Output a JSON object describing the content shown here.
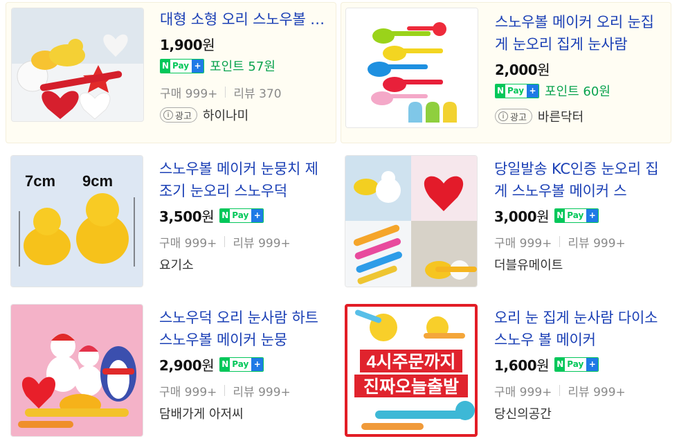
{
  "products": [
    {
      "title": "대형 소형 오리 스노우볼 메이커",
      "price": "1,900",
      "currency": "원",
      "npay": {
        "n": "N",
        "pay": "Pay",
        "plus": "+"
      },
      "point": "포인트 57원",
      "purchase": "구매 999+",
      "review": "리뷰 370",
      "ad_label": "광고",
      "ad_info": "i",
      "seller": "하이나미"
    },
    {
      "title": "스노우볼 메이커 오리 눈집게 눈오리 집게 눈사람",
      "price": "2,000",
      "currency": "원",
      "npay": {
        "n": "N",
        "pay": "Pay",
        "plus": "+"
      },
      "point": "포인트 60원",
      "ad_label": "광고",
      "ad_info": "i",
      "seller": "바른닥터"
    },
    {
      "title": "스노우볼 메이커 눈뭉치 제조기 눈오리 스노우덕",
      "price": "3,500",
      "currency": "원",
      "npay": {
        "n": "N",
        "pay": "Pay",
        "plus": "+"
      },
      "purchase": "구매 999+",
      "review": "리뷰 999+",
      "seller": "요기소",
      "image_text": {
        "left": "7cm",
        "right": "9cm"
      }
    },
    {
      "title": "당일발송 KC인증 눈오리 집게 스노우볼 메이커 스",
      "price": "3,000",
      "currency": "원",
      "npay": {
        "n": "N",
        "pay": "Pay",
        "plus": "+"
      },
      "purchase": "구매 999+",
      "review": "리뷰 999+",
      "seller": "더블유메이트"
    },
    {
      "title": "스노우덕 오리 눈사람 하트 스노우볼 메이커 눈뭉",
      "price": "2,900",
      "currency": "원",
      "npay": {
        "n": "N",
        "pay": "Pay",
        "plus": "+"
      },
      "purchase": "구매 999+",
      "review": "리뷰 999+",
      "seller": "담배가게 아저씨"
    },
    {
      "title": "오리 눈 집게 눈사람 다이소 스노우 볼 메이커",
      "price": "1,600",
      "currency": "원",
      "npay": {
        "n": "N",
        "pay": "Pay",
        "plus": "+"
      },
      "purchase": "구매 999+",
      "review": "리뷰 999+",
      "seller": "당신의공간",
      "image_text": {
        "line1": "4시주문까지",
        "line2": "진짜오늘출발"
      }
    }
  ],
  "colors": {
    "title_link": "#1a3fb5",
    "npay_green": "#03c75a",
    "npay_blue": "#1f7ae6",
    "point_green": "#0aa34f",
    "ad_card_bg": "#fffdf3"
  }
}
